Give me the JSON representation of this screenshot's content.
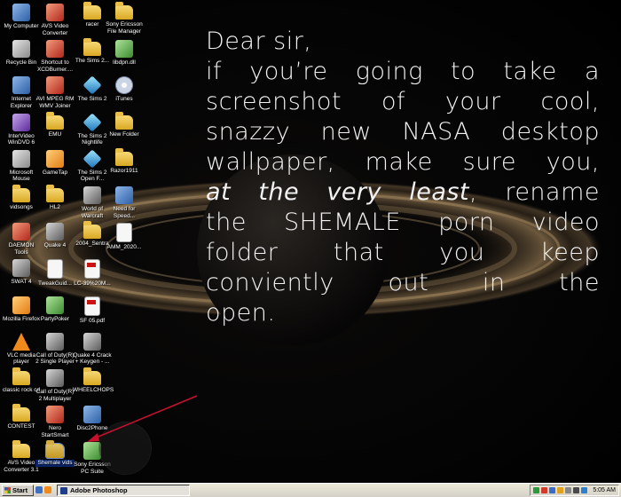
{
  "desktop_icons": [
    {
      "label": "My Computer",
      "col": 0,
      "row": 0,
      "type": "app",
      "icon": "computer-icon"
    },
    {
      "label": "AVS Video Converter",
      "col": 1,
      "row": 0,
      "type": "red",
      "icon": "video-converter-icon"
    },
    {
      "label": "racer",
      "col": 2,
      "row": 0,
      "type": "folder",
      "icon": "folder-icon"
    },
    {
      "label": "Sony Ericsson File Manager",
      "col": 3,
      "row": 0,
      "type": "folder",
      "icon": "folder-icon"
    },
    {
      "label": "Recycle Bin",
      "col": 0,
      "row": 1,
      "type": "gray",
      "icon": "recycle-bin-icon"
    },
    {
      "label": "Shortcut to XCDBurner....",
      "col": 1,
      "row": 1,
      "type": "red",
      "icon": "shortcut-icon"
    },
    {
      "label": "The Sims 2...",
      "col": 2,
      "row": 1,
      "type": "folder",
      "icon": "folder-icon"
    },
    {
      "label": "libdpn.dll",
      "col": 3,
      "row": 1,
      "type": "green",
      "icon": "dll-file-icon"
    },
    {
      "label": "Internet Explorer",
      "col": 0,
      "row": 2,
      "type": "app",
      "icon": "internet-explorer-icon"
    },
    {
      "label": "AVI MPEG RM WMV Joiner",
      "col": 1,
      "row": 2,
      "type": "red",
      "icon": "joiner-app-icon"
    },
    {
      "label": "The Sims 2",
      "col": 2,
      "row": 2,
      "type": "sims",
      "icon": "sims-icon"
    },
    {
      "label": "iTunes",
      "col": 3,
      "row": 2,
      "type": "cd",
      "icon": "itunes-icon"
    },
    {
      "label": "InterVideo WinDVD 6",
      "col": 0,
      "row": 3,
      "type": "purple",
      "icon": "windvd-icon"
    },
    {
      "label": "EMU",
      "col": 1,
      "row": 3,
      "type": "folder",
      "icon": "folder-icon"
    },
    {
      "label": "The Sims 2 Nightlife",
      "col": 2,
      "row": 3,
      "type": "sims",
      "icon": "sims-icon"
    },
    {
      "label": "New Folder",
      "col": 3,
      "row": 3,
      "type": "folder",
      "icon": "folder-icon"
    },
    {
      "label": "Microsoft Mouse",
      "col": 0,
      "row": 4,
      "type": "gray",
      "icon": "mouse-icon"
    },
    {
      "label": "GameTap",
      "col": 1,
      "row": 4,
      "type": "orange",
      "icon": "gametap-icon"
    },
    {
      "label": "The Sims 2 Open F...",
      "col": 2,
      "row": 4,
      "type": "sims",
      "icon": "sims-icon"
    },
    {
      "label": "Razor1911",
      "col": 3,
      "row": 4,
      "type": "folder",
      "icon": "folder-icon"
    },
    {
      "label": "vidsongs",
      "col": 0,
      "row": 5,
      "type": "folder",
      "icon": "folder-icon"
    },
    {
      "label": "HL2",
      "col": 1,
      "row": 5,
      "type": "folder",
      "icon": "folder-icon"
    },
    {
      "label": "World of Warcraft",
      "col": 2,
      "row": 5,
      "type": "game",
      "icon": "warcraft-icon"
    },
    {
      "label": "Need for Speed...",
      "col": 3,
      "row": 5,
      "type": "app",
      "icon": "need-for-speed-icon"
    },
    {
      "label": "DAEMON Tools",
      "col": 0,
      "row": 6,
      "type": "red",
      "icon": "daemon-tools-icon"
    },
    {
      "label": "Quake 4",
      "col": 1,
      "row": 6,
      "type": "game",
      "icon": "quake-icon"
    },
    {
      "label": "2004_Sentra",
      "col": 2,
      "row": 6,
      "type": "folder",
      "icon": "folder-icon"
    },
    {
      "label": "AMM_2020...",
      "col": 3,
      "row": 6,
      "type": "doc",
      "icon": "document-icon"
    },
    {
      "label": "SWAT 4",
      "col": 0,
      "row": 7,
      "type": "game",
      "icon": "swat-icon"
    },
    {
      "label": "TweakGuid...",
      "col": 1,
      "row": 7,
      "type": "doc",
      "icon": "document-icon"
    },
    {
      "label": "LC-39%20M...",
      "col": 2,
      "row": 7,
      "type": "pdf",
      "icon": "pdf-icon"
    },
    {
      "label": "Mozilla Firefox",
      "col": 0,
      "row": 8,
      "type": "orange",
      "icon": "firefox-icon"
    },
    {
      "label": "PartyPoker",
      "col": 1,
      "row": 8,
      "type": "green",
      "icon": "partypoker-icon"
    },
    {
      "label": "SF 05.pdf",
      "col": 2,
      "row": 8,
      "type": "pdf",
      "icon": "pdf-icon"
    },
    {
      "label": "VLC media player",
      "col": 0,
      "row": 9,
      "type": "cone",
      "icon": "vlc-icon"
    },
    {
      "label": "Call of Duty(R) 2 Single Player",
      "col": 1,
      "row": 9,
      "type": "game",
      "icon": "call-of-duty-icon"
    },
    {
      "label": "Quake 4 Crack + Keygen - ...",
      "col": 2,
      "row": 9,
      "type": "game",
      "icon": "quake-icon"
    },
    {
      "label": "classic rock cd",
      "col": 0,
      "row": 10,
      "type": "folder",
      "icon": "folder-icon"
    },
    {
      "label": "Call of Duty(R) 2 Multiplayer",
      "col": 1,
      "row": 10,
      "type": "game",
      "icon": "call-of-duty-icon"
    },
    {
      "label": "WHEELCHOPS",
      "col": 2,
      "row": 10,
      "type": "folder",
      "icon": "folder-icon"
    },
    {
      "label": "CONTEST",
      "col": 0,
      "row": 11,
      "type": "folder",
      "icon": "folder-icon"
    },
    {
      "label": "Nero StartSmart",
      "col": 1,
      "row": 11,
      "type": "red",
      "icon": "nero-icon"
    },
    {
      "label": "Disc2Phone",
      "col": 2,
      "row": 11,
      "type": "app",
      "icon": "disc2phone-icon"
    },
    {
      "label": "AVS Video Converter 3.1",
      "col": 0,
      "row": 12,
      "type": "folder",
      "icon": "folder-icon"
    },
    {
      "label": "Shemale vids",
      "col": 1,
      "row": 12,
      "type": "folder",
      "icon": "folder-icon",
      "selected": true
    },
    {
      "label": "Sony Ericsson PC Suite",
      "col": 2,
      "row": 12,
      "type": "green",
      "icon": "pc-suite-icon"
    }
  ],
  "message": {
    "l1": "Dear sir,",
    "l2": "if you’re going to take a",
    "l3": "screenshot of your cool,",
    "l4": "snazzy new NASA desktop",
    "l5": "wallpaper, make sure you,",
    "l6_em": "at the very least",
    "l6_rest": ", rename",
    "l7": "the SHEMALE porn video",
    "l8": "folder that you keep",
    "l9": "conviently out in the",
    "l10": "open."
  },
  "taskbar": {
    "start_label": "Start",
    "active_window": "Adobe Photoshop",
    "clock": "5:05 AM"
  },
  "colors": {
    "text": "#f2f2f2",
    "arrow": "#c8102e",
    "selection": "#0a246a",
    "taskbar": "#d4d0c8"
  }
}
